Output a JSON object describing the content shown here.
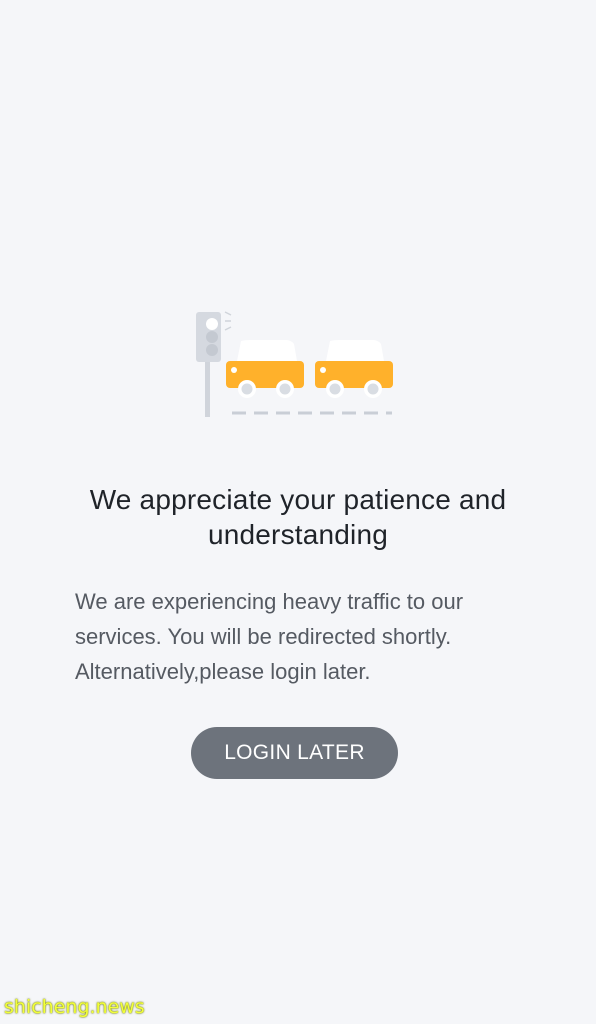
{
  "page": {
    "title": "We appreciate your patience and understanding",
    "message": "We are experiencing heavy traffic to our services. You will be redirected shortly. Alternatively,please login later.",
    "button_label": "LOGIN LATER"
  },
  "illustration": {
    "icon_name": "traffic-cars-icon",
    "car_color": "#ffb12b",
    "pole_color": "#cfd3da"
  },
  "watermark": {
    "text": "shicheng.news"
  },
  "colors": {
    "background": "#f5f6f9",
    "title_text": "#1f2329",
    "body_text": "#555a62",
    "button_bg": "#6d737c",
    "button_text": "#ffffff"
  }
}
